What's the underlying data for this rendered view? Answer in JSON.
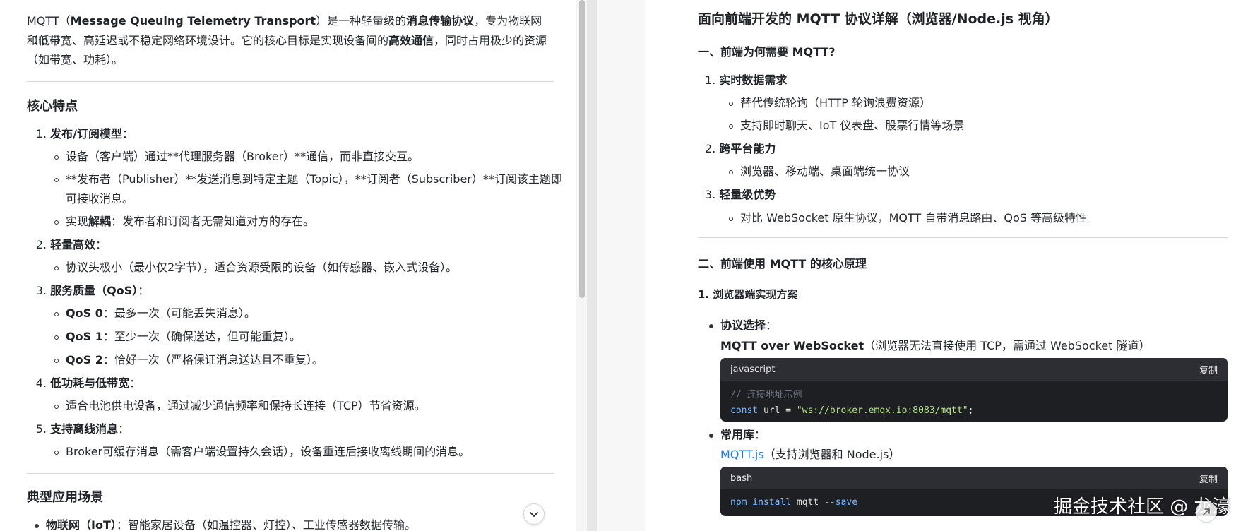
{
  "left": {
    "intro": {
      "p1_a": "MQTT（",
      "p1_b": "Message Queuing Telemetry Transport",
      "p1_c": "）是一种轻量级的",
      "p1_d": "消息传输协议",
      "p1_e": "，专为物联网（IoT）",
      "p2_a": "和低带宽、高延迟或不稳定网络环境设计。它的核心目标是实现设备间的",
      "p2_b": "高效通信",
      "p2_c": "，同时占用极少的资源",
      "p3": "（如带宽、功耗）。"
    },
    "h_core": "核心特点",
    "items": [
      {
        "num": "1.",
        "title": "发布/订阅模型",
        "colon": "：",
        "subs": [
          {
            "text": "设备（客户端）通过**代理服务器（Broker）**通信，而非直接交互。"
          },
          {
            "text": "**发布者（Publisher）**发送消息到特定主题（Topic），**订阅者（Subscriber）**订阅该主题即",
            "cont": "可接收消息。"
          },
          {
            "a": "实现",
            "b": "解耦",
            "c": "：发布者和订阅者无需知道对方的存在。"
          }
        ]
      },
      {
        "num": "2.",
        "title": "轻量高效",
        "colon": "：",
        "subs": [
          {
            "text": "协议头极小（最小仅2字节），适合资源受限的设备（如传感器、嵌入式设备）。"
          }
        ]
      },
      {
        "num": "3.",
        "title": "服务质量（QoS）",
        "colon": "：",
        "subs": [
          {
            "b": "QoS 0",
            "c": "：最多一次（可能丢失消息）。"
          },
          {
            "b": "QoS 1",
            "c": "：至少一次（确保送达，但可能重复）。"
          },
          {
            "b": "QoS 2",
            "c": "：恰好一次（严格保证消息送达且不重复）。"
          }
        ]
      },
      {
        "num": "4.",
        "title": "低功耗与低带宽",
        "colon": "：",
        "subs": [
          {
            "text": "适合电池供电设备，通过减少通信频率和保持长连接（TCP）节省资源。"
          }
        ]
      },
      {
        "num": "5.",
        "title": "支持离线消息",
        "colon": "：",
        "subs": [
          {
            "text": "Broker可缓存消息（需客户端设置持久会话），设备重连后接收离线期间的消息。"
          }
        ]
      }
    ],
    "h_scenes": "典型应用场景",
    "scene1_b": "物联网（IoT）",
    "scene1_c": "：智能家居设备（如温控器、灯控）、工业传感器数据传输。"
  },
  "right": {
    "title": "面向前端开发的 MQTT 协议详解（浏览器/Node.js 视角）",
    "h1": "一、前端为何需要 MQTT?",
    "reasons": [
      {
        "num": "1.",
        "title": "实时数据需求",
        "subs": [
          "替代传统轮询（HTTP 轮询浪费资源）",
          "支持即时聊天、IoT 仪表盘、股票行情等场景"
        ]
      },
      {
        "num": "2.",
        "title": "跨平台能力",
        "subs": [
          "浏览器、移动端、桌面端统一协议"
        ]
      },
      {
        "num": "3.",
        "title": "轻量级优势",
        "subs": [
          "对比 WebSocket 原生协议，MQTT 自带消息路由、QoS 等高级特性"
        ]
      }
    ],
    "h2": "二、前端使用 MQTT 的核心原理",
    "h2_1": "1. 浏览器端实现方案",
    "proto_label": "协议选择",
    "proto_colon": "：",
    "proto_b": "MQTT over WebSocket",
    "proto_c": "（浏览器无法直接使用 TCP，需通过 WebSocket 隧道）",
    "code1": {
      "lang": "javascript",
      "copy": "复制",
      "comment": "// 连接地址示例",
      "kw": "const",
      "var": " url ",
      "eq": "=",
      "str": " \"ws://broker.emqx.io:8083/mqtt\"",
      "end": ";"
    },
    "lib_label": "常用库",
    "lib_colon": "：",
    "lib_link": "MQTT.js",
    "lib_text": "（支持浏览器和 Node.js）",
    "code2": {
      "lang": "bash",
      "copy": "复制",
      "cmd1": "npm",
      "cmd2": " install",
      "cmd3": " mqtt",
      "cmd4": " --save"
    },
    "watermark": "掘金技术社区 @ 龙濠"
  },
  "icons": {
    "expand": "chevron-down-icon",
    "corner": "arrow-icon"
  }
}
